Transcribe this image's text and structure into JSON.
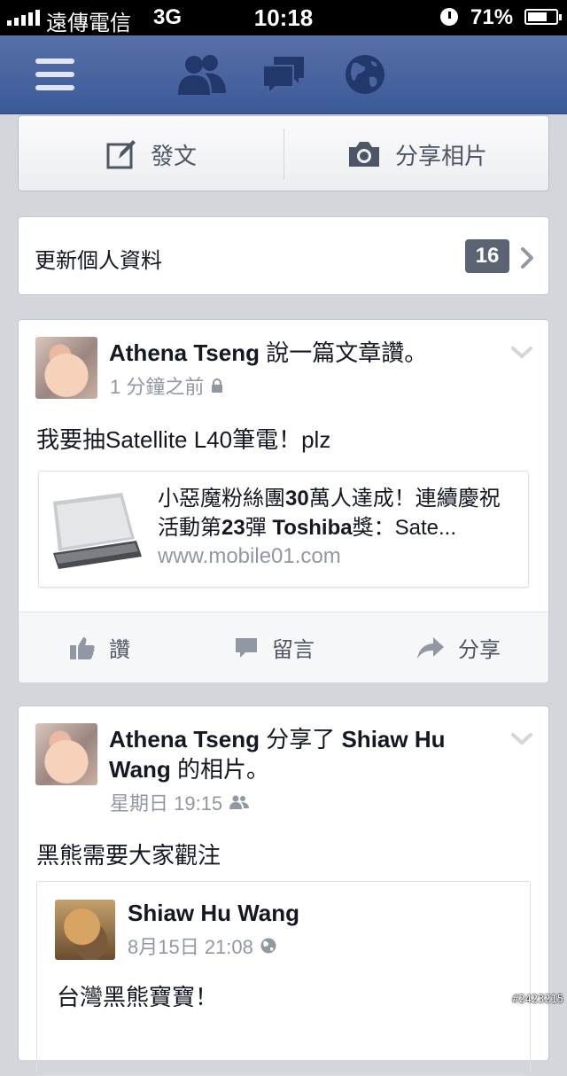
{
  "status_bar": {
    "carrier": "遠傳電信",
    "network": "3G",
    "time": "10:18",
    "battery": "71%",
    "battery_level": 0.71
  },
  "nav": {
    "icons": [
      "menu-icon",
      "friend-requests-icon",
      "messages-icon",
      "notifications-globe-icon"
    ]
  },
  "composer": {
    "post_label": "發文",
    "photo_label": "分享相片"
  },
  "profile_update": {
    "label": "更新個人資料",
    "count": "16"
  },
  "post1": {
    "author": "Athena Tseng",
    "action": "說一篇文章讚。",
    "time": "1 分鐘之前",
    "text": "我要抽Satellite L40筆電！plz",
    "link": {
      "title_prefix": "小惡魔粉絲團",
      "title_b1": "30",
      "title_mid1": "萬人達成！連續慶祝活動第",
      "title_b2": "23",
      "title_mid2": "彈 ",
      "title_b3": "Toshiba",
      "title_suffix": "獎：Sate...",
      "url": "www.mobile01.com"
    },
    "actions": {
      "like": "讚",
      "comment": "留言",
      "share": "分享"
    }
  },
  "post2": {
    "author": "Athena Tseng",
    "action": "分享了",
    "target": "Shiaw Hu Wang",
    "suffix": "的相片。",
    "time": "星期日 19:15",
    "text": "黑熊需要大家觀注",
    "shared": {
      "name": "Shiaw Hu Wang",
      "time": "8月15日 21:08",
      "text": "台灣黑熊寶寶！"
    }
  },
  "watermark": "#2423215",
  "colors": {
    "nav_blue": "#3b5998",
    "background": "#d3d6db",
    "meta_gray": "#9197a3"
  }
}
